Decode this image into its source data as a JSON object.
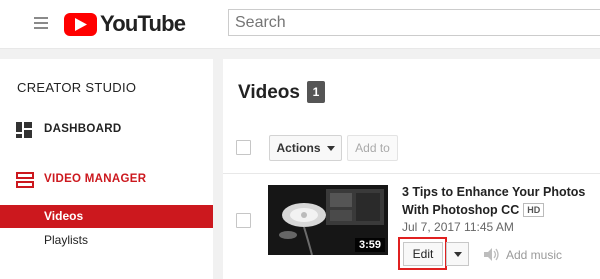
{
  "header": {
    "logo_text": "YouTube",
    "search_placeholder": "Search",
    "brand_color": "#ff0000"
  },
  "sidebar": {
    "title": "CREATOR STUDIO",
    "items": [
      {
        "label": "DASHBOARD",
        "icon": "dashboard-icon"
      },
      {
        "label": "VIDEO MANAGER",
        "icon": "video-manager-icon",
        "active": true
      }
    ],
    "subitems": [
      {
        "label": "Videos",
        "selected": true
      },
      {
        "label": "Playlists"
      }
    ],
    "accent_color": "#cc181e"
  },
  "main": {
    "title": "Videos",
    "count": "1",
    "toolbar": {
      "actions_label": "Actions",
      "add_to_label": "Add to"
    },
    "video": {
      "title": "3 Tips to Enhance Your Photos With Photoshop CC",
      "quality_badge": "HD",
      "date": "Jul 7, 2017 11:45 AM",
      "duration": "3:59",
      "edit_label": "Edit",
      "add_music_label": "Add music"
    }
  }
}
